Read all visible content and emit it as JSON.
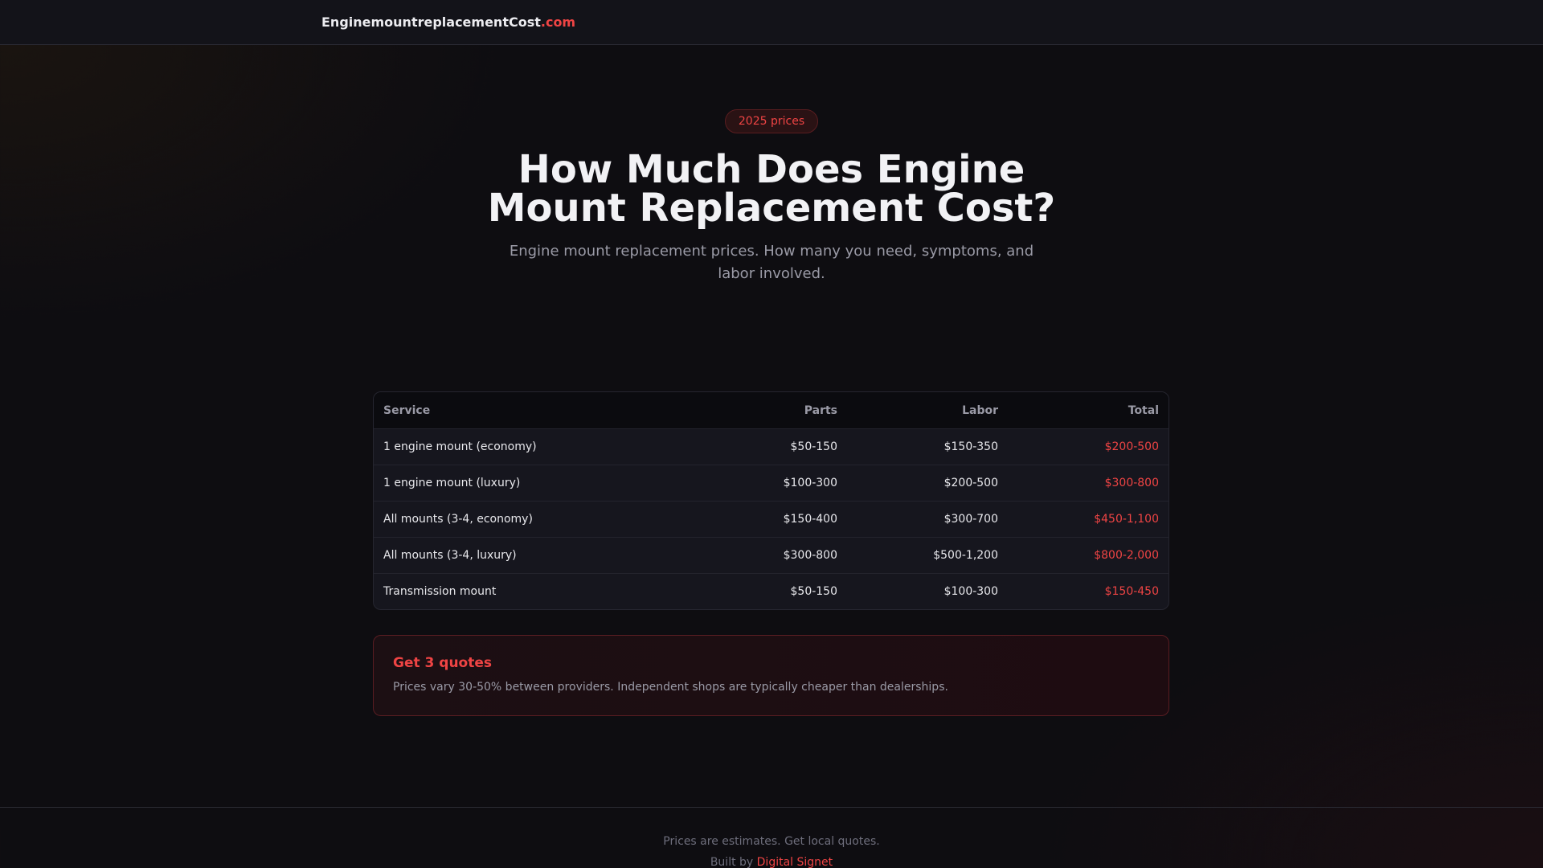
{
  "header": {
    "logo_main": "EnginemountreplacementCost",
    "logo_tld": ".com"
  },
  "hero": {
    "badge": "2025 prices",
    "title_line1": "How Much Does Engine",
    "title_line2": "Mount Replacement Cost?",
    "subtitle": "Engine mount replacement prices. How many you need, symptoms, and labor involved."
  },
  "table": {
    "headers": [
      "Service",
      "Parts",
      "Labor",
      "Total"
    ],
    "rows": [
      [
        "1 engine mount (economy)",
        "$50-150",
        "$150-350",
        "$200-500"
      ],
      [
        "1 engine mount (luxury)",
        "$100-300",
        "$200-500",
        "$300-800"
      ],
      [
        "All mounts (3-4, economy)",
        "$150-400",
        "$300-700",
        "$450-1,100"
      ],
      [
        "All mounts (3-4, luxury)",
        "$300-800",
        "$500-1,200",
        "$800-2,000"
      ],
      [
        "Transmission mount",
        "$50-150",
        "$100-300",
        "$150-450"
      ]
    ]
  },
  "callout": {
    "title": "Get 3 quotes",
    "text": "Prices vary 30-50% between providers. Independent shops are typically cheaper than dealerships."
  },
  "footer": {
    "note": "Prices are estimates. Get local quotes.",
    "built_by": "Built by",
    "author": "Digital Signet"
  },
  "colors": {
    "accent": "#ef4444",
    "background": "#0e0d11"
  }
}
